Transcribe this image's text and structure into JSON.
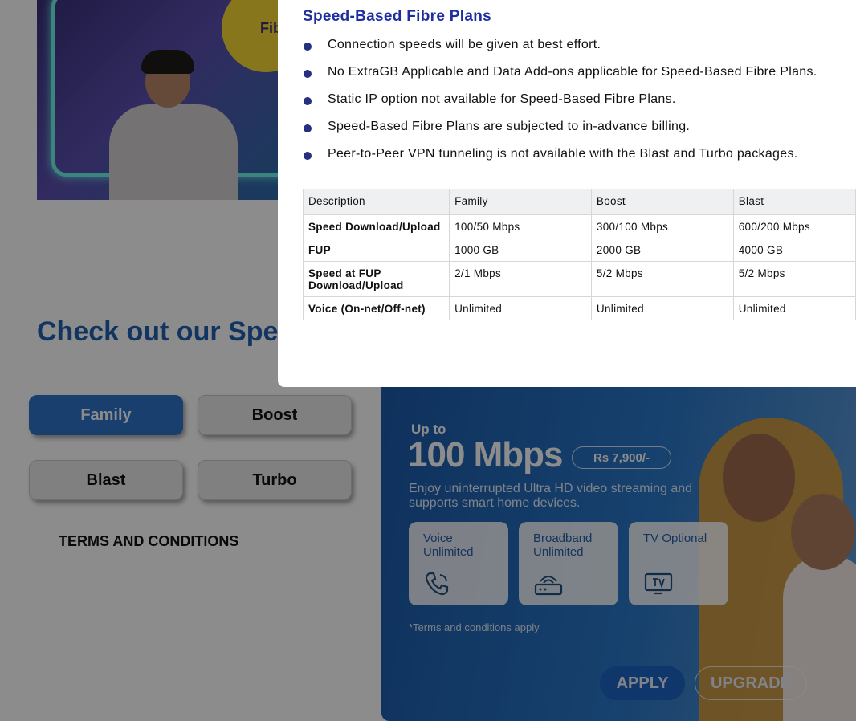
{
  "hero": {
    "balloon_text": "Fibre"
  },
  "section": {
    "heading": "Check out our Speed-Based Fibre Plans"
  },
  "plan_buttons": [
    {
      "label": "Family",
      "active": true
    },
    {
      "label": "Boost",
      "active": false
    },
    {
      "label": "Blast",
      "active": false
    },
    {
      "label": "Turbo",
      "active": false
    }
  ],
  "terms_label": "TERMS AND CONDITIONS",
  "promo": {
    "upto": "Up to",
    "speed": "100 Mbps",
    "price": "Rs 7,900/-",
    "tagline": "Enjoy uninterrupted Ultra HD video streaming and supports smart home devices.",
    "features": [
      {
        "label": "Voice Unlimited",
        "icon": "phone-icon"
      },
      {
        "label": "Broadband Unlimited",
        "icon": "router-icon"
      },
      {
        "label": "TV Optional",
        "icon": "tv-icon"
      }
    ],
    "fine_print": "*Terms and conditions apply",
    "apply_label": "APPLY",
    "upgrade_label": "UPGRADE"
  },
  "modal": {
    "title": "Speed-Based Fibre Plans",
    "bullets": [
      "Connection speeds will be given at best effort.",
      "No ExtraGB Applicable and Data Add-ons applicable for Speed-Based Fibre Plans.",
      "Static IP option not available for Speed-Based Fibre Plans.",
      "Speed-Based Fibre Plans are subjected to in-advance billing.",
      "Peer-to-Peer VPN tunneling is not available with the Blast and Turbo packages."
    ],
    "table": {
      "headers": [
        "Description",
        "Family",
        "Boost",
        "Blast"
      ],
      "rows": [
        [
          "Speed Download/Upload",
          "100/50 Mbps",
          "300/100 Mbps",
          "600/200 Mbps"
        ],
        [
          "FUP",
          "1000 GB",
          "2000 GB",
          "4000 GB"
        ],
        [
          "Speed at FUP Download/Upload",
          "2/1 Mbps",
          "5/2 Mbps",
          "5/2 Mbps"
        ],
        [
          "Voice (On-net/Off-net)",
          "Unlimited",
          "Unlimited",
          "Unlimited"
        ]
      ]
    }
  }
}
